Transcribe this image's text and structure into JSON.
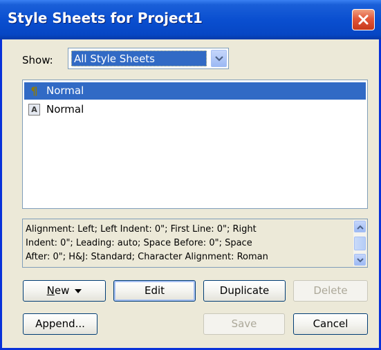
{
  "window": {
    "title": "Style Sheets for Project1",
    "close_icon": "close-icon"
  },
  "show": {
    "label": "Show:",
    "selected": "All Style Sheets"
  },
  "style_list": {
    "items": [
      {
        "label": "Normal",
        "icon": "paragraph-style-icon",
        "selected": true
      },
      {
        "label": "Normal",
        "icon": "character-style-icon",
        "selected": false
      }
    ]
  },
  "description": {
    "lines": [
      "Alignment: Left;  Left Indent: 0\";  First Line: 0\";  Right",
      "Indent: 0\";  Leading: auto;  Space Before: 0\";  Space",
      "After: 0\";  H&J: Standard;  Character Alignment: Roman"
    ]
  },
  "buttons": {
    "new_mnemonic": "N",
    "new_rest": "ew",
    "edit": "Edit",
    "duplicate": "Duplicate",
    "delete": "Delete",
    "append": "Append...",
    "save": "Save",
    "cancel": "Cancel"
  },
  "colors": {
    "title_bar": "#0a4fd0",
    "selection": "#316ac5",
    "dialog_face": "#ece9d8",
    "close_button": "#e2573a"
  }
}
